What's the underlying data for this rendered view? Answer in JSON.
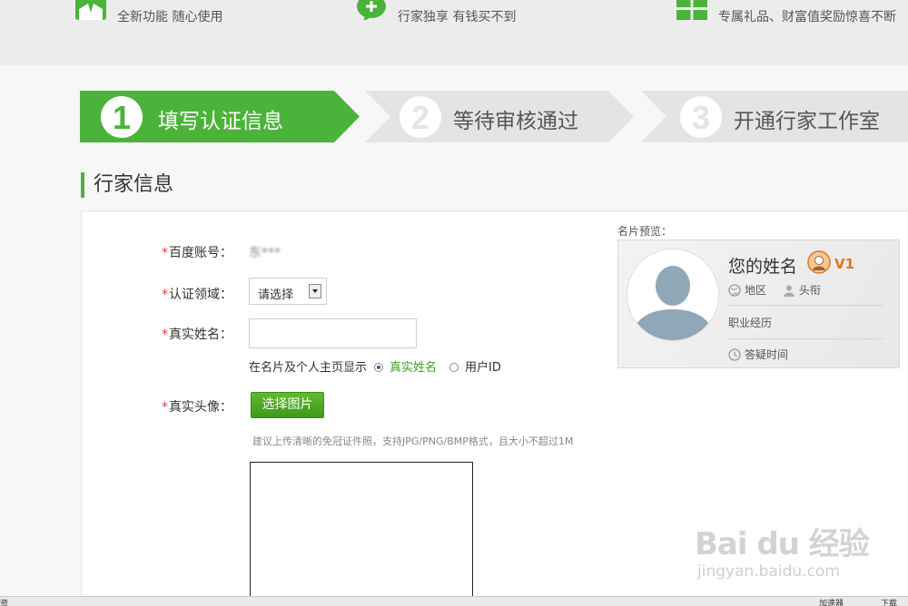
{
  "features": [
    {
      "title": "",
      "subtitle": "全新功能 随心使用",
      "icon": "user-badge-icon"
    },
    {
      "title": "",
      "subtitle": "行家独享 有钱买不到",
      "icon": "chat-plus-icon"
    },
    {
      "title": "",
      "subtitle": "专属礼品、财富值奖励惊喜不断",
      "icon": "grid-gift-icon"
    }
  ],
  "steps": [
    {
      "number": "1",
      "label": "填写认证信息",
      "active": true
    },
    {
      "number": "2",
      "label": "等待审核通过",
      "active": false
    },
    {
      "number": "3",
      "label": "开通行家工作室",
      "active": false
    }
  ],
  "section": {
    "title": "行家信息"
  },
  "form": {
    "required_mark": "*",
    "account_label": "百度账号：",
    "account_value": "东***",
    "domain_label": "认证领域：",
    "domain_selected": "请选择",
    "realname_label": "真实姓名：",
    "realname_value": "",
    "display_prefix": "在名片及个人主页显示",
    "display_option_realname": "真实姓名",
    "display_option_userid": "用户ID",
    "avatar_label": "真实头像：",
    "choose_button": "选择图片",
    "upload_hint": "建议上传清晰的免冠证件照，支持JPG/PNG/BMP格式，且大小不超过1M"
  },
  "preview": {
    "label": "名片预览：",
    "name": "您的姓名",
    "level": "V1",
    "region": "地区",
    "title": "头衔",
    "career": "职业经历",
    "answer_time": "答疑时间"
  },
  "watermark": {
    "brand": "Bai du 经验",
    "url": "jingyan.baidu.com"
  },
  "statusbar": {
    "left": "资",
    "speed": "加速器",
    "download": "下载"
  },
  "colors": {
    "accent_green": "#4cb33a",
    "level_orange": "#e0791d",
    "required_red": "#e4393c",
    "step_inactive": "#e4e4e4"
  }
}
